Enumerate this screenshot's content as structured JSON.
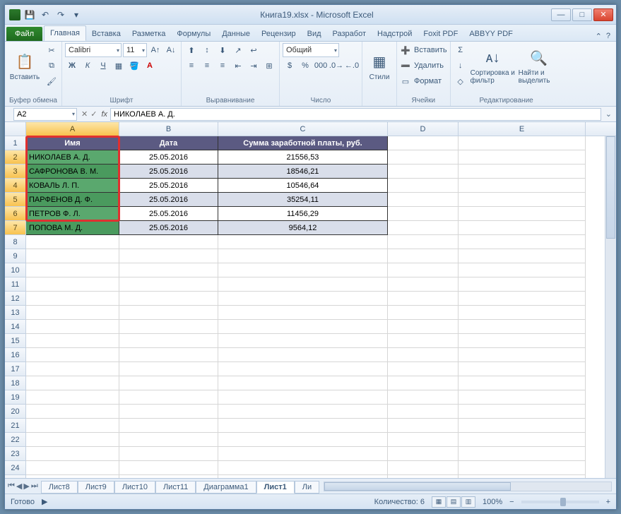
{
  "title": "Книга19.xlsx - Microsoft Excel",
  "qat": {
    "save": "💾",
    "undo": "↶",
    "redo": "↷"
  },
  "tabs": {
    "file": "Файл",
    "items": [
      "Главная",
      "Вставка",
      "Разметка",
      "Формулы",
      "Данные",
      "Рецензир",
      "Вид",
      "Разработ",
      "Надстрой",
      "Foxit PDF",
      "ABBYY PDF"
    ],
    "active": 0
  },
  "ribbon": {
    "clipboard": {
      "paste": "Вставить",
      "label": "Буфер обмена"
    },
    "font": {
      "name": "Calibri",
      "size": "11",
      "label": "Шрифт"
    },
    "align": {
      "label": "Выравнивание"
    },
    "number": {
      "format": "Общий",
      "label": "Число"
    },
    "styles": {
      "btn": "Стили",
      "label": ""
    },
    "cells": {
      "insert": "Вставить",
      "delete": "Удалить",
      "format": "Формат",
      "label": "Ячейки"
    },
    "editing": {
      "sort": "Сортировка и фильтр",
      "find": "Найти и выделить",
      "label": "Редактирование"
    }
  },
  "namebox": "A2",
  "formula": "НИКОЛАЕВ А. Д.",
  "columns": [
    "A",
    "B",
    "C",
    "D",
    "E"
  ],
  "table": {
    "headers": [
      "Имя",
      "Дата",
      "Сумма заработной платы, руб."
    ],
    "rows": [
      {
        "name": "НИКОЛАЕВ А. Д.",
        "date": "25.05.2016",
        "sum": "21556,53"
      },
      {
        "name": "САФРОНОВА В. М.",
        "date": "25.05.2016",
        "sum": "18546,21"
      },
      {
        "name": "КОВАЛЬ Л. П.",
        "date": "25.05.2016",
        "sum": "10546,64"
      },
      {
        "name": "ПАРФЕНОВ Д. Ф.",
        "date": "25.05.2016",
        "sum": "35254,11"
      },
      {
        "name": "ПЕТРОВ Ф. Л.",
        "date": "25.05.2016",
        "sum": "11456,29"
      },
      {
        "name": "ПОПОВА М. Д.",
        "date": "25.05.2016",
        "sum": "9564,12"
      }
    ]
  },
  "sheets": [
    "Лист8",
    "Лист9",
    "Лист10",
    "Лист11",
    "Диаграмма1",
    "Лист1",
    "Ли"
  ],
  "active_sheet": 5,
  "status": {
    "ready": "Готово",
    "count": "Количество: 6",
    "zoom": "100%"
  }
}
